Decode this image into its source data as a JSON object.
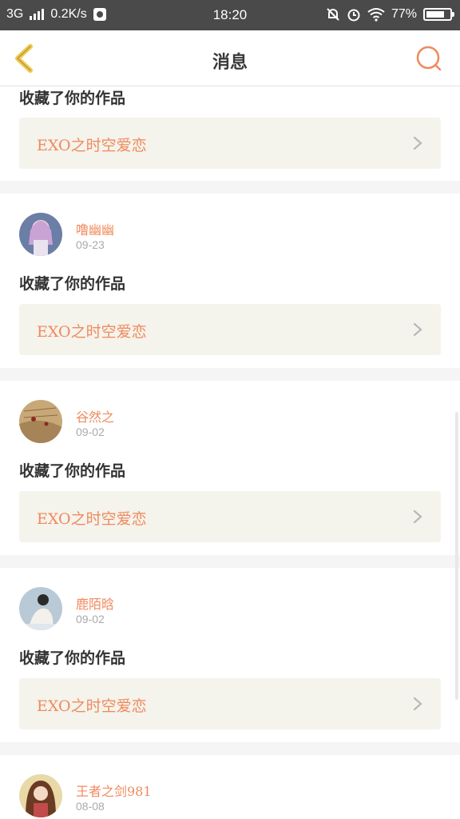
{
  "status_bar": {
    "network": "3G",
    "speed": "0.2K/s",
    "time": "18:20",
    "battery": "77%",
    "battery_level": 0.77
  },
  "header": {
    "title": "消息"
  },
  "colors": {
    "accent": "#f08a5d",
    "back_icon": "#f2c84b",
    "work_box_bg": "#f4f3ec"
  },
  "feed": {
    "items": [
      {
        "action": "收藏了你的作品",
        "work_title": "EXO之时空爱恋"
      },
      {
        "username": "噜幽幽",
        "date": "09-23",
        "action": "收藏了你的作品",
        "work_title": "EXO之时空爱恋",
        "avatar": "anime-girl-purple-hair"
      },
      {
        "username": "谷然之",
        "date": "09-02",
        "action": "收藏了你的作品",
        "work_title": "EXO之时空爱恋",
        "avatar": "book-page-red-petals"
      },
      {
        "username": "鹿陌晗",
        "date": "09-02",
        "action": "收藏了你的作品",
        "work_title": "EXO之时空爱恋",
        "avatar": "girl-white-dress"
      },
      {
        "username": "王者之剑981",
        "date": "08-08",
        "avatar": "anime-girl-brown-hair"
      }
    ]
  }
}
